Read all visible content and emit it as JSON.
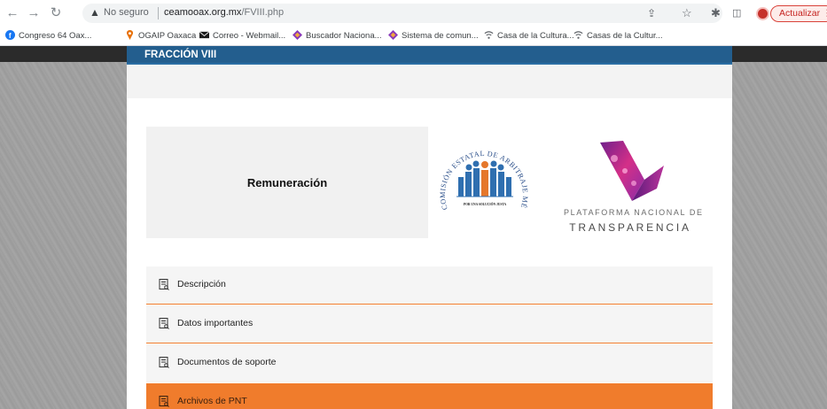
{
  "browser": {
    "security_label": "No seguro",
    "url_host": "ceamooax.org.mx",
    "url_path": "/FVIII.php",
    "update_label": "Actualizar"
  },
  "bookmarks": [
    {
      "label": "Congreso 64 Oax...",
      "icon": "facebook-icon",
      "color": "#1877f2"
    },
    {
      "label": "OGAIP Oaxaca",
      "icon": "map-pin-icon",
      "color": "#e8710a"
    },
    {
      "label": "Correo - Webmail...",
      "icon": "mail-icon",
      "color": "#1a1a1a"
    },
    {
      "label": "Buscador Naciona...",
      "icon": "diamond-icon",
      "color": "#8a3ab9"
    },
    {
      "label": "Sistema de comun...",
      "icon": "diamond-icon",
      "color": "#8a3ab9"
    },
    {
      "label": "Casa de la Cultura...",
      "icon": "wifi-icon",
      "color": "#5f6368"
    },
    {
      "label": "Casas de la Cultur...",
      "icon": "wifi-icon",
      "color": "#5f6368"
    }
  ],
  "page": {
    "section_title": "FRACCIÓN VIII",
    "remuneracion_label": "Remuneración",
    "cea_logo": {
      "ring_text": "COMISIÓN ESTATAL DE ARBITRAJE MÉDICO DE OAXACA",
      "motto": "POR UNA SOLUCIÓN JUSTA"
    },
    "pnt_line1": "PLATAFORMA NACIONAL DE",
    "pnt_line2": "TRANSPARENCIA",
    "menu": [
      {
        "label": "Descripción",
        "active": false
      },
      {
        "label": "Datos importantes",
        "active": false
      },
      {
        "label": "Documentos de soporte",
        "active": false
      },
      {
        "label": "Archivos de PNT",
        "active": true
      }
    ]
  },
  "colors": {
    "header_blue": "#235e8e",
    "accent_orange": "#f07c2c",
    "menu_bg": "#f5f5f5"
  }
}
